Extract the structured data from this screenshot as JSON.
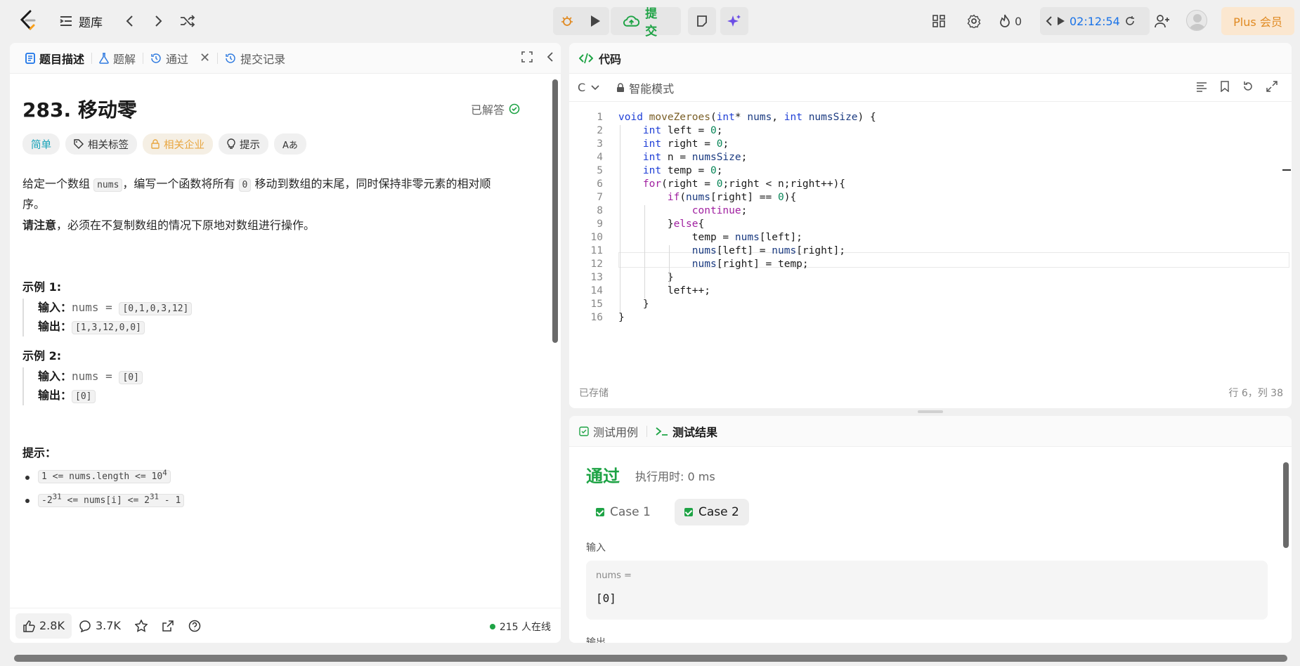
{
  "topbar": {
    "problemset_label": "题库",
    "submit_label": "提交",
    "streak": "0",
    "timer": "02:12:54",
    "plus_label": "Plus 会员"
  },
  "left_tabs": [
    {
      "label": "题目描述"
    },
    {
      "label": "题解"
    },
    {
      "label": "通过"
    },
    {
      "label": "提交记录"
    }
  ],
  "problem": {
    "title": "283. 移动零",
    "status": "已解答",
    "tags": [
      "简单",
      "相关标签",
      "相关企业",
      "提示",
      "Aあ"
    ],
    "desc_1": "给定一个数组",
    "desc_nums": "nums",
    "desc_2": "，编写一个函数将所有",
    "desc_zero": "0",
    "desc_3": "移动到数组的末尾，同时保持非零元素的相对顺",
    "desc_4": "序。",
    "note_bold": "请注意",
    "note_rest": "，必须在不复制数组的情况下原地对数组进行操作。",
    "example1_h": "示例 1:",
    "example1_in_label": "输入：",
    "example1_in_pre": "nums = ",
    "example1_in": "[0,1,0,3,12]",
    "example1_out_label": "输出：",
    "example1_out": "[1,3,12,0,0]",
    "example2_h": "示例 2:",
    "example2_in_label": "输入：",
    "example2_in_pre": "nums = ",
    "example2_in": "[0]",
    "example2_out_label": "输出：",
    "example2_out": "[0]",
    "hints_h": "提示：",
    "hint1": "1 <= nums.length <= 10",
    "hint1_sup": "4",
    "hint2_a": "-2",
    "hint2_sup1": "31",
    "hint2_b": " <= nums[i] <= 2",
    "hint2_sup2": "31",
    "hint2_c": " - 1"
  },
  "footer": {
    "likes": "2.8K",
    "comments": "3.7K",
    "online": "215 人在线"
  },
  "code": {
    "header": "代码",
    "language": "C",
    "mode": "智能模式",
    "saved": "已存储",
    "position": "行 6，列 38",
    "lines": [
      "void moveZeroes(int* nums, int numsSize) {",
      "    int left = 0;",
      "    int right = 0;",
      "    int n = numsSize;",
      "    int temp = 0;",
      "    for(right = 0;right < n;right++){",
      "        if(nums[right] == 0){",
      "            continue;",
      "        }else{",
      "            temp = nums[left];",
      "            nums[left] = nums[right];",
      "            nums[right] = temp;",
      "        }",
      "        left++;",
      "    }",
      "}"
    ]
  },
  "test": {
    "tab_cases": "测试用例",
    "tab_result": "测试结果",
    "result": "通过",
    "runtime": "执行用时: 0 ms",
    "case1": "Case 1",
    "case2": "Case 2",
    "input_label": "输入",
    "var_label": "nums =",
    "var_value": "[0]",
    "output_label": "输出"
  },
  "colors": {
    "accent_green": "#1ea345",
    "easy": "#16a2b8",
    "plus": "#e08a22",
    "timer": "#1a73e8"
  }
}
